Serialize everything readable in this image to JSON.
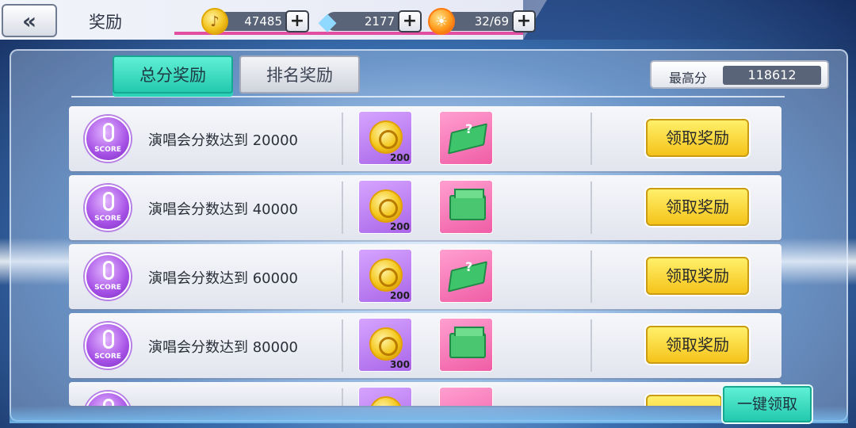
{
  "header": {
    "back_icon": "double-chevron-left-icon",
    "title": "奖励",
    "resources": [
      {
        "name": "coins",
        "icon": "coin-icon",
        "value": "47485"
      },
      {
        "name": "diamonds",
        "icon": "diamond-icon",
        "value": "2177"
      },
      {
        "name": "energy",
        "icon": "energy-icon",
        "value": "32/69"
      }
    ],
    "plus_label": "+"
  },
  "tabs": [
    {
      "label": "总分奖励",
      "active": true
    },
    {
      "label": "排名奖励",
      "active": false
    }
  ],
  "best_score": {
    "label": "最高分",
    "value": "118612"
  },
  "rows": [
    {
      "icon_text": "SCORE",
      "text": "演唱会分数达到 20000",
      "rewards": [
        {
          "type": "coin",
          "qty": "200"
        },
        {
          "type": "ticket"
        }
      ],
      "button": "领取奖励"
    },
    {
      "icon_text": "SCORE",
      "text": "演唱会分数达到 40000",
      "rewards": [
        {
          "type": "coin",
          "qty": "200"
        },
        {
          "type": "pack"
        }
      ],
      "button": "领取奖励"
    },
    {
      "icon_text": "SCORE",
      "text": "演唱会分数达到 60000",
      "rewards": [
        {
          "type": "coin",
          "qty": "200"
        },
        {
          "type": "ticket"
        }
      ],
      "button": "领取奖励"
    },
    {
      "icon_text": "SCORE",
      "text": "演唱会分数达到 80000",
      "rewards": [
        {
          "type": "coin",
          "qty": "300"
        },
        {
          "type": "pack"
        }
      ],
      "button": "领取奖励"
    },
    {
      "icon_text": "",
      "text": "",
      "rewards": [
        {
          "type": "coin",
          "qty": ""
        },
        {
          "type": "ticket"
        }
      ],
      "button": ""
    }
  ],
  "one_key_button": "一键领取",
  "colors": {
    "accent_pink": "#e24fa0",
    "tab_active": "#2ad2b8",
    "claim_button": "#f5c31a",
    "score_badge": "#a651e6"
  }
}
